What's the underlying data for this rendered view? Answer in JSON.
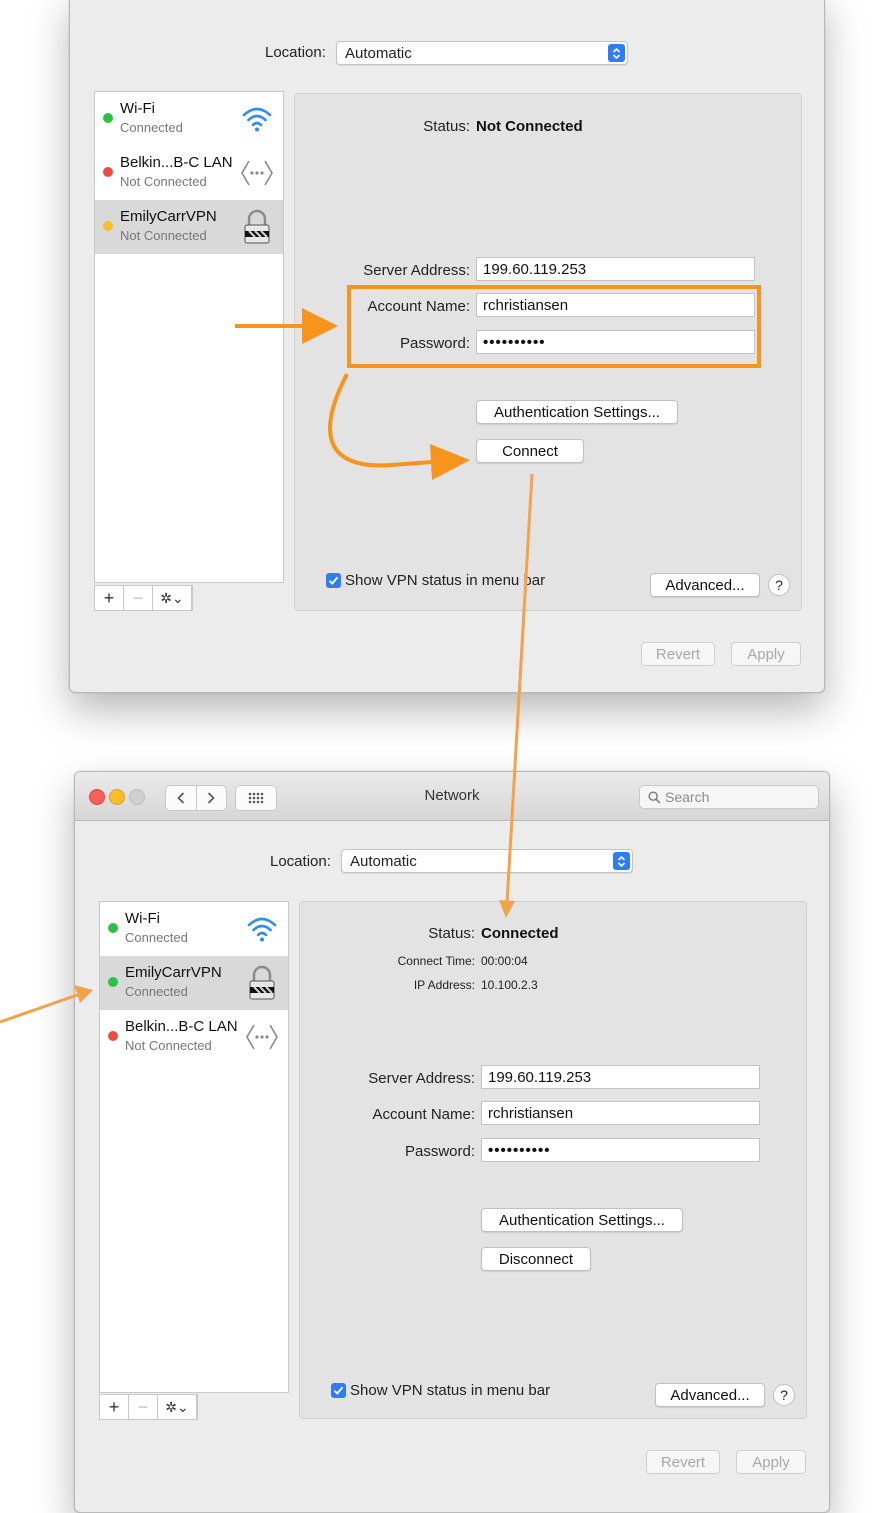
{
  "before": {
    "location": {
      "label": "Location:",
      "value": "Automatic"
    },
    "services": [
      {
        "name": "Wi-Fi",
        "status": "Connected",
        "dot": "#2bc244",
        "icon": "wifi-icon"
      },
      {
        "name": "Belkin...B-C LAN",
        "status": "Not Connected",
        "dot": "#ed4a42",
        "icon": "ethernet-icon"
      },
      {
        "name": "EmilyCarrVPN",
        "status": "Not Connected",
        "dot": "#f5c02a",
        "icon": "vpn-lock-icon"
      }
    ],
    "status": {
      "label": "Status:",
      "value": "Not Connected"
    },
    "server_address": {
      "label": "Server Address:",
      "value": "199.60.119.253"
    },
    "account_name": {
      "label": "Account Name:",
      "value": "rchristiansen"
    },
    "password": {
      "label": "Password:",
      "value": "••••••••••"
    },
    "auth_button": "Authentication Settings...",
    "connect_button": "Connect",
    "show_vpn_label": "Show VPN status in menu bar",
    "advanced_button": "Advanced...",
    "help_button": "?",
    "revert_button": "Revert",
    "apply_button": "Apply"
  },
  "after": {
    "window_title": "Network",
    "search_placeholder": "Search",
    "location": {
      "label": "Location:",
      "value": "Automatic"
    },
    "services": [
      {
        "name": "Wi-Fi",
        "status": "Connected",
        "dot": "#2bc244",
        "icon": "wifi-icon"
      },
      {
        "name": "EmilyCarrVPN",
        "status": "Connected",
        "dot": "#2bc244",
        "icon": "vpn-lock-icon"
      },
      {
        "name": "Belkin...B-C LAN",
        "status": "Not Connected",
        "dot": "#ed4a42",
        "icon": "ethernet-icon"
      }
    ],
    "status": {
      "label": "Status:",
      "value": "Connected"
    },
    "connect_time": {
      "label": "Connect Time:",
      "value": "00:00:04"
    },
    "ip_address": {
      "label": "IP Address:",
      "value": "10.100.2.3"
    },
    "server_address": {
      "label": "Server Address:",
      "value": "199.60.119.253"
    },
    "account_name": {
      "label": "Account Name:",
      "value": "rchristiansen"
    },
    "password": {
      "label": "Password:",
      "value": "••••••••••"
    },
    "auth_button": "Authentication Settings...",
    "disconnect_button": "Disconnect",
    "show_vpn_label": "Show VPN status in menu bar",
    "advanced_button": "Advanced...",
    "help_button": "?",
    "revert_button": "Revert",
    "apply_button": "Apply"
  },
  "colors": {
    "annotation": "#f7941d",
    "accent": "#2f7cf6"
  }
}
